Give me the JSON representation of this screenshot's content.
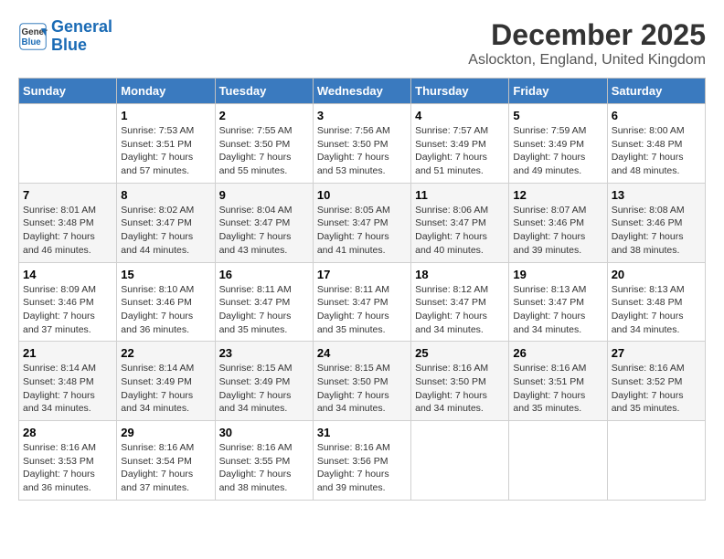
{
  "logo": {
    "line1": "General",
    "line2": "Blue"
  },
  "title": "December 2025",
  "subtitle": "Aslockton, England, United Kingdom",
  "days_of_week": [
    "Sunday",
    "Monday",
    "Tuesday",
    "Wednesday",
    "Thursday",
    "Friday",
    "Saturday"
  ],
  "weeks": [
    [
      {
        "day": "",
        "info": ""
      },
      {
        "day": "1",
        "info": "Sunrise: 7:53 AM\nSunset: 3:51 PM\nDaylight: 7 hours\nand 57 minutes."
      },
      {
        "day": "2",
        "info": "Sunrise: 7:55 AM\nSunset: 3:50 PM\nDaylight: 7 hours\nand 55 minutes."
      },
      {
        "day": "3",
        "info": "Sunrise: 7:56 AM\nSunset: 3:50 PM\nDaylight: 7 hours\nand 53 minutes."
      },
      {
        "day": "4",
        "info": "Sunrise: 7:57 AM\nSunset: 3:49 PM\nDaylight: 7 hours\nand 51 minutes."
      },
      {
        "day": "5",
        "info": "Sunrise: 7:59 AM\nSunset: 3:49 PM\nDaylight: 7 hours\nand 49 minutes."
      },
      {
        "day": "6",
        "info": "Sunrise: 8:00 AM\nSunset: 3:48 PM\nDaylight: 7 hours\nand 48 minutes."
      }
    ],
    [
      {
        "day": "7",
        "info": "Sunrise: 8:01 AM\nSunset: 3:48 PM\nDaylight: 7 hours\nand 46 minutes."
      },
      {
        "day": "8",
        "info": "Sunrise: 8:02 AM\nSunset: 3:47 PM\nDaylight: 7 hours\nand 44 minutes."
      },
      {
        "day": "9",
        "info": "Sunrise: 8:04 AM\nSunset: 3:47 PM\nDaylight: 7 hours\nand 43 minutes."
      },
      {
        "day": "10",
        "info": "Sunrise: 8:05 AM\nSunset: 3:47 PM\nDaylight: 7 hours\nand 41 minutes."
      },
      {
        "day": "11",
        "info": "Sunrise: 8:06 AM\nSunset: 3:47 PM\nDaylight: 7 hours\nand 40 minutes."
      },
      {
        "day": "12",
        "info": "Sunrise: 8:07 AM\nSunset: 3:46 PM\nDaylight: 7 hours\nand 39 minutes."
      },
      {
        "day": "13",
        "info": "Sunrise: 8:08 AM\nSunset: 3:46 PM\nDaylight: 7 hours\nand 38 minutes."
      }
    ],
    [
      {
        "day": "14",
        "info": "Sunrise: 8:09 AM\nSunset: 3:46 PM\nDaylight: 7 hours\nand 37 minutes."
      },
      {
        "day": "15",
        "info": "Sunrise: 8:10 AM\nSunset: 3:46 PM\nDaylight: 7 hours\nand 36 minutes."
      },
      {
        "day": "16",
        "info": "Sunrise: 8:11 AM\nSunset: 3:47 PM\nDaylight: 7 hours\nand 35 minutes."
      },
      {
        "day": "17",
        "info": "Sunrise: 8:11 AM\nSunset: 3:47 PM\nDaylight: 7 hours\nand 35 minutes."
      },
      {
        "day": "18",
        "info": "Sunrise: 8:12 AM\nSunset: 3:47 PM\nDaylight: 7 hours\nand 34 minutes."
      },
      {
        "day": "19",
        "info": "Sunrise: 8:13 AM\nSunset: 3:47 PM\nDaylight: 7 hours\nand 34 minutes."
      },
      {
        "day": "20",
        "info": "Sunrise: 8:13 AM\nSunset: 3:48 PM\nDaylight: 7 hours\nand 34 minutes."
      }
    ],
    [
      {
        "day": "21",
        "info": "Sunrise: 8:14 AM\nSunset: 3:48 PM\nDaylight: 7 hours\nand 34 minutes."
      },
      {
        "day": "22",
        "info": "Sunrise: 8:14 AM\nSunset: 3:49 PM\nDaylight: 7 hours\nand 34 minutes."
      },
      {
        "day": "23",
        "info": "Sunrise: 8:15 AM\nSunset: 3:49 PM\nDaylight: 7 hours\nand 34 minutes."
      },
      {
        "day": "24",
        "info": "Sunrise: 8:15 AM\nSunset: 3:50 PM\nDaylight: 7 hours\nand 34 minutes."
      },
      {
        "day": "25",
        "info": "Sunrise: 8:16 AM\nSunset: 3:50 PM\nDaylight: 7 hours\nand 34 minutes."
      },
      {
        "day": "26",
        "info": "Sunrise: 8:16 AM\nSunset: 3:51 PM\nDaylight: 7 hours\nand 35 minutes."
      },
      {
        "day": "27",
        "info": "Sunrise: 8:16 AM\nSunset: 3:52 PM\nDaylight: 7 hours\nand 35 minutes."
      }
    ],
    [
      {
        "day": "28",
        "info": "Sunrise: 8:16 AM\nSunset: 3:53 PM\nDaylight: 7 hours\nand 36 minutes."
      },
      {
        "day": "29",
        "info": "Sunrise: 8:16 AM\nSunset: 3:54 PM\nDaylight: 7 hours\nand 37 minutes."
      },
      {
        "day": "30",
        "info": "Sunrise: 8:16 AM\nSunset: 3:55 PM\nDaylight: 7 hours\nand 38 minutes."
      },
      {
        "day": "31",
        "info": "Sunrise: 8:16 AM\nSunset: 3:56 PM\nDaylight: 7 hours\nand 39 minutes."
      },
      {
        "day": "",
        "info": ""
      },
      {
        "day": "",
        "info": ""
      },
      {
        "day": "",
        "info": ""
      }
    ]
  ]
}
